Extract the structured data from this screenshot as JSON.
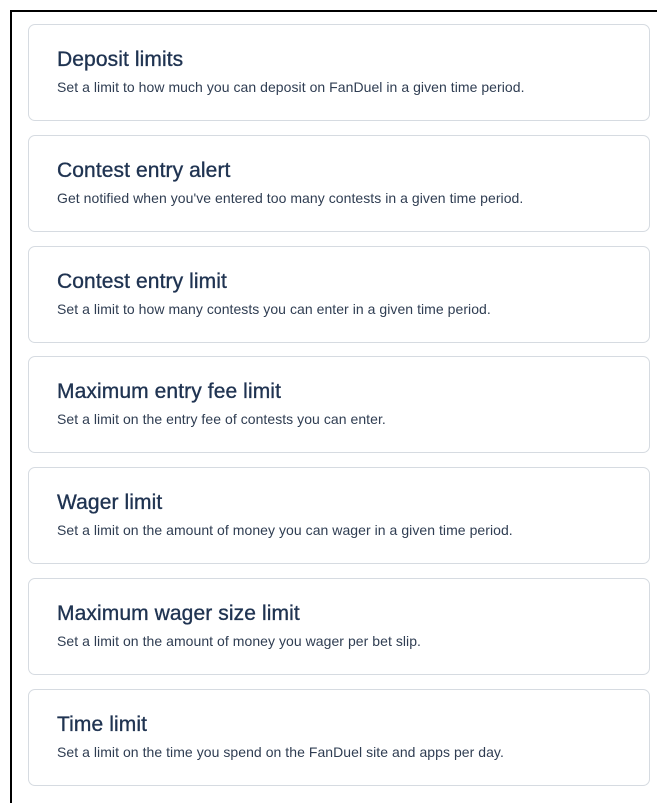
{
  "limits": [
    {
      "title": "Deposit limits",
      "description": "Set a limit to how much you can deposit on FanDuel in a given time period."
    },
    {
      "title": "Contest entry alert",
      "description": "Get notified when you've entered too many contests in a given time period."
    },
    {
      "title": "Contest entry limit",
      "description": "Set a limit to how many contests you can enter in a given time period."
    },
    {
      "title": "Maximum entry fee limit",
      "description": "Set a limit on the entry fee of contests you can enter."
    },
    {
      "title": "Wager limit",
      "description": "Set a limit on the amount of money you can wager in a given time period."
    },
    {
      "title": "Maximum wager size limit",
      "description": "Set a limit on the amount of money you wager per bet slip."
    },
    {
      "title": "Time limit",
      "description": "Set a limit on the time you spend on the FanDuel site and apps per day."
    }
  ]
}
